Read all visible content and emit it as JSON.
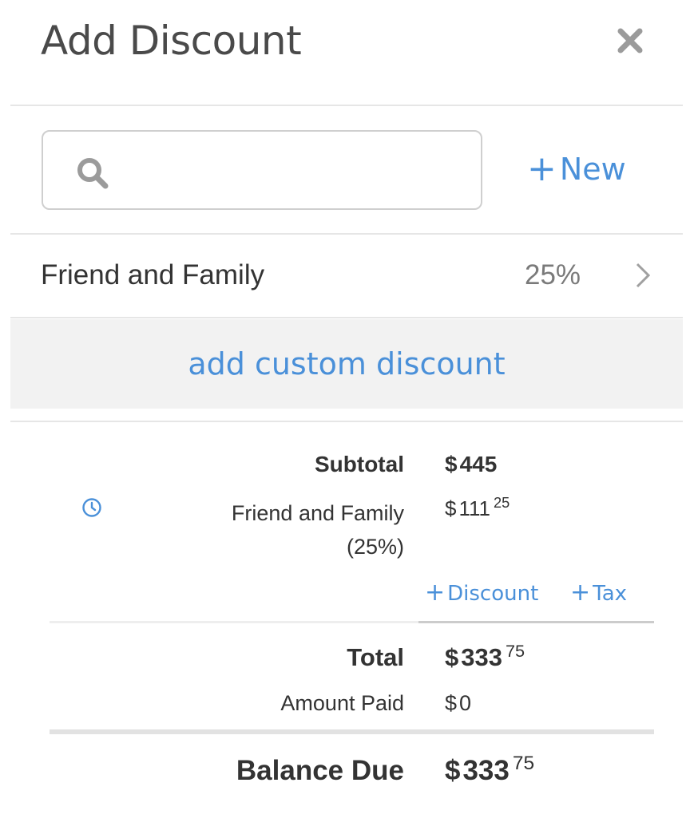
{
  "header": {
    "title": "Add Discount",
    "close_icon": "close-icon"
  },
  "search": {
    "value": "",
    "placeholder": "",
    "icon": "search-icon"
  },
  "new_button": {
    "plus": "+",
    "label": "New"
  },
  "discounts": [
    {
      "name": "Friend and Family",
      "percent": "25%",
      "icon": "chevron-right-icon"
    }
  ],
  "custom_discount": {
    "label": "add custom discount"
  },
  "summary": {
    "subtotal": {
      "label": "Subtotal",
      "currency": "$",
      "amount": "445",
      "cents": ""
    },
    "discount_line": {
      "label_line1": "Friend and Family",
      "label_line2": "(25%)",
      "currency": "$",
      "amount": "111",
      "cents": "25",
      "icon": "clock-icon"
    },
    "add_discount": {
      "plus": "+",
      "label": "Discount"
    },
    "add_tax": {
      "plus": "+",
      "label": "Tax"
    },
    "total": {
      "label": "Total",
      "currency": "$",
      "amount": "333",
      "cents": "75"
    },
    "amount_paid": {
      "label": "Amount Paid",
      "currency": "$",
      "amount": "0"
    },
    "balance_due": {
      "label": "Balance Due",
      "currency": "$",
      "amount": "333",
      "cents": "75"
    }
  },
  "colors": {
    "accent": "#4a90d9",
    "text": "#333333",
    "muted": "#7a7a7a",
    "band": "#f2f2f2"
  }
}
